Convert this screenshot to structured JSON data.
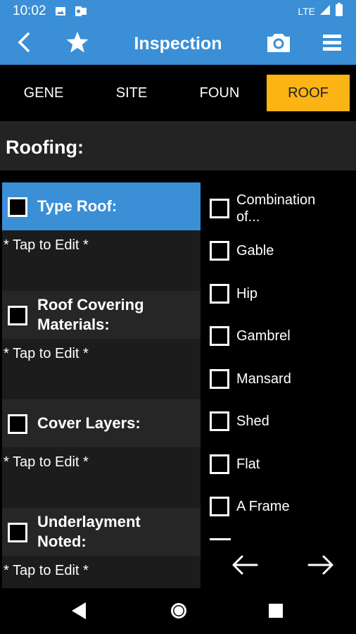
{
  "status": {
    "time": "10:02",
    "network": "LTE",
    "icons": [
      "image-icon",
      "outlook-icon",
      "signal-icon",
      "battery-icon"
    ]
  },
  "appbar": {
    "title": "Inspection",
    "icons": [
      "back-icon",
      "star-icon",
      "camera-icon",
      "menu-icon"
    ]
  },
  "tabs": [
    {
      "label": "GENE",
      "active": false
    },
    {
      "label": "SITE",
      "active": false
    },
    {
      "label": "FOUN",
      "active": false
    },
    {
      "label": "ROOF",
      "active": true
    }
  ],
  "section": {
    "title": "Roofing:"
  },
  "fields": [
    {
      "label": "Type Roof:",
      "value": "* Tap to Edit *",
      "selected": true
    },
    {
      "label": "Roof Covering Materials:",
      "value": "* Tap to Edit *",
      "selected": false
    },
    {
      "label": "Cover Layers:",
      "value": "* Tap to Edit *",
      "selected": false
    },
    {
      "label": "Underlayment Noted:",
      "value": "* Tap to Edit *",
      "selected": false
    }
  ],
  "options": [
    {
      "label": "Combination of...",
      "checked": false
    },
    {
      "label": "Gable",
      "checked": false
    },
    {
      "label": "Hip",
      "checked": false
    },
    {
      "label": "Gambrel",
      "checked": false
    },
    {
      "label": "Mansard",
      "checked": false
    },
    {
      "label": "Shed",
      "checked": false
    },
    {
      "label": "Flat",
      "checked": false
    },
    {
      "label": "A Frame",
      "checked": false
    }
  ],
  "pager": {
    "prev_icon": "arrow-left-icon",
    "next_icon": "arrow-right-icon"
  },
  "colors": {
    "accent": "#3a8fd6",
    "active_tab": "#fbb414",
    "background": "#000000"
  }
}
